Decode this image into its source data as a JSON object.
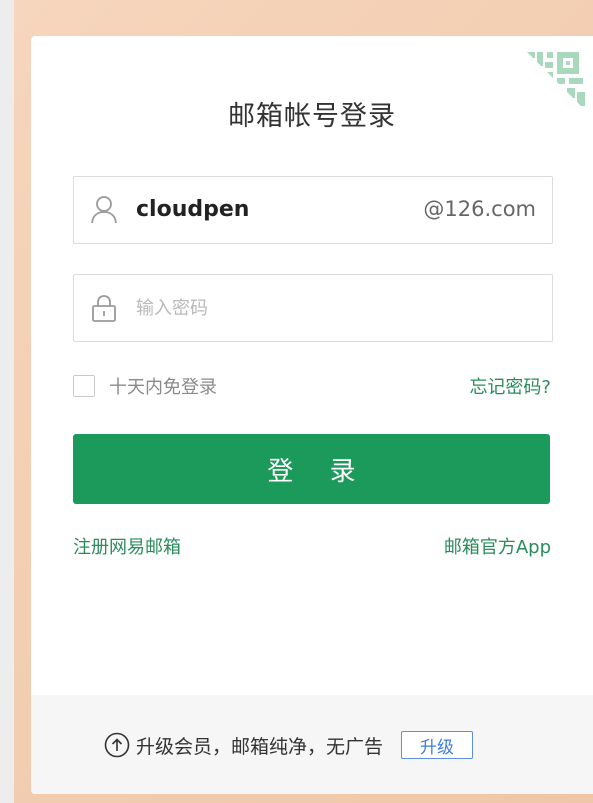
{
  "login": {
    "title": "邮箱帐号登录",
    "username_value": "cloudpen",
    "domain_suffix": "@126.com",
    "password_placeholder": "输入密码",
    "remember_label": "十天内免登录",
    "forgot_link": "忘记密码?",
    "login_button": "登 录",
    "register_link": "注册网易邮箱",
    "app_link": "邮箱官方App"
  },
  "footer": {
    "promo_text": "升级会员，邮箱纯净，无广告",
    "upgrade_button": "升级"
  },
  "icons": {
    "qr_corner": "qr-code-icon",
    "user": "user-icon",
    "lock": "lock-icon",
    "upgrade": "arrow-up-circle-icon"
  },
  "colors": {
    "accent_green": "#1b9a5b",
    "link_green": "#2a8c5b",
    "upgrade_blue": "#3f7de0",
    "qr_green": "#9fd4b4"
  }
}
